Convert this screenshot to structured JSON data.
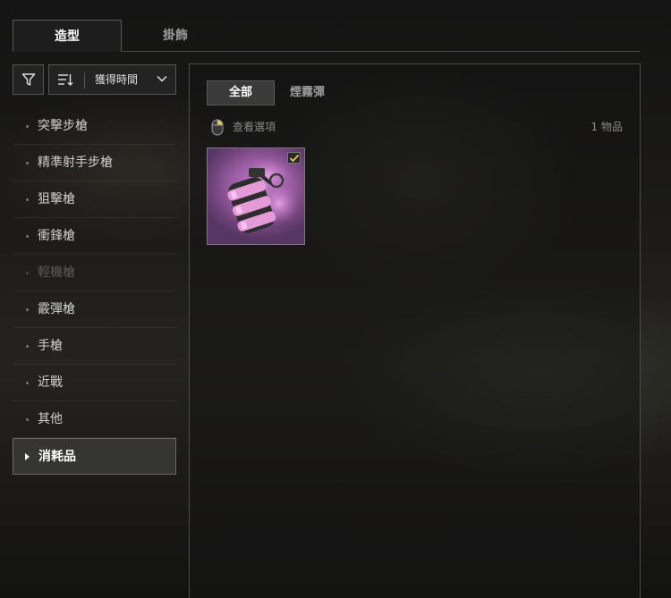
{
  "top_tabs": [
    {
      "label": "造型",
      "active": true
    },
    {
      "label": "掛飾",
      "active": false
    }
  ],
  "toolbar": {
    "filter_icon": "filter-icon",
    "sort_icon": "sort-icon",
    "sort_label": "獲得時間",
    "dropdown_icon": "chevron-down-icon"
  },
  "categories": [
    {
      "label": "突擊步槍",
      "state": "normal"
    },
    {
      "label": "精準射手步槍",
      "state": "normal"
    },
    {
      "label": "狙擊槍",
      "state": "normal"
    },
    {
      "label": "衝鋒槍",
      "state": "normal"
    },
    {
      "label": "輕機槍",
      "state": "disabled"
    },
    {
      "label": "霰彈槍",
      "state": "normal"
    },
    {
      "label": "手槍",
      "state": "normal"
    },
    {
      "label": "近戰",
      "state": "normal"
    },
    {
      "label": "其他",
      "state": "normal"
    },
    {
      "label": "消耗品",
      "state": "selected"
    }
  ],
  "main": {
    "sub_tabs": [
      {
        "label": "全部",
        "active": true
      },
      {
        "label": "煙霧彈",
        "active": false
      }
    ],
    "view_options_label": "查看選項",
    "view_options_icon": "mouse-icon",
    "item_count": "1 物品",
    "items": [
      {
        "icon": "smoke-grenade-icon",
        "equipped": true
      }
    ]
  },
  "colors": {
    "item_background": "#a865b0",
    "check": "#e8c94a",
    "selected_bg": "#3a3a3a"
  }
}
